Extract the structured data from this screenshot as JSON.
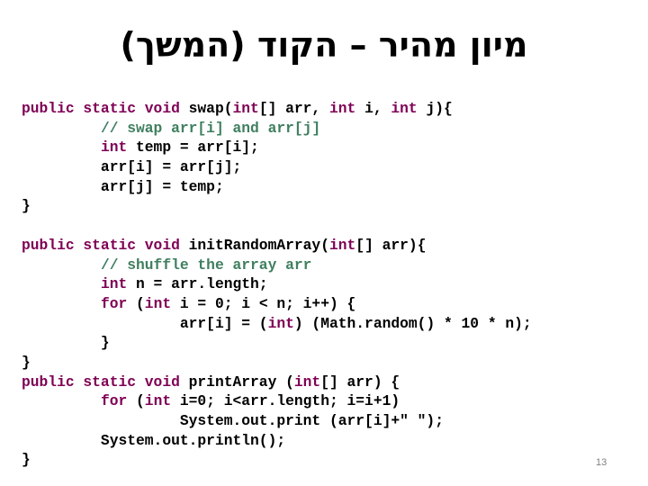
{
  "slide": {
    "title": "מיון מהיר – הקוד (המשך)",
    "page_number": "13",
    "colors": {
      "keyword": "#7f0055",
      "comment": "#3f7f5f",
      "text": "#000000"
    }
  },
  "code_lines": [
    [
      {
        "t": "kw",
        "s": "public static void"
      },
      {
        "t": "tx",
        "s": " swap("
      },
      {
        "t": "kw",
        "s": "int"
      },
      {
        "t": "tx",
        "s": "[] arr, "
      },
      {
        "t": "kw",
        "s": "int"
      },
      {
        "t": "tx",
        "s": " i, "
      },
      {
        "t": "kw",
        "s": "int"
      },
      {
        "t": "tx",
        "s": " j){"
      }
    ],
    [
      {
        "t": "tx",
        "s": "         "
      },
      {
        "t": "cm",
        "s": "// swap arr[i] and arr[j]"
      }
    ],
    [
      {
        "t": "tx",
        "s": "         "
      },
      {
        "t": "kw",
        "s": "int"
      },
      {
        "t": "tx",
        "s": " temp = arr[i];"
      }
    ],
    [
      {
        "t": "tx",
        "s": "         arr[i] = arr[j];"
      }
    ],
    [
      {
        "t": "tx",
        "s": "         arr[j] = temp;"
      }
    ],
    [
      {
        "t": "tx",
        "s": "}"
      }
    ],
    [
      {
        "t": "tx",
        "s": ""
      }
    ],
    [
      {
        "t": "kw",
        "s": "public static void"
      },
      {
        "t": "tx",
        "s": " initRandomArray("
      },
      {
        "t": "kw",
        "s": "int"
      },
      {
        "t": "tx",
        "s": "[] arr){"
      }
    ],
    [
      {
        "t": "tx",
        "s": "         "
      },
      {
        "t": "cm",
        "s": "// shuffle the array arr"
      }
    ],
    [
      {
        "t": "tx",
        "s": "         "
      },
      {
        "t": "kw",
        "s": "int"
      },
      {
        "t": "tx",
        "s": " n = arr.length;"
      }
    ],
    [
      {
        "t": "tx",
        "s": "         "
      },
      {
        "t": "kw",
        "s": "for"
      },
      {
        "t": "tx",
        "s": " ("
      },
      {
        "t": "kw",
        "s": "int"
      },
      {
        "t": "tx",
        "s": " i = 0; i < n; i++) {"
      }
    ],
    [
      {
        "t": "tx",
        "s": "                  arr[i] = ("
      },
      {
        "t": "kw",
        "s": "int"
      },
      {
        "t": "tx",
        "s": ") (Math.random() * 10 * n);"
      }
    ],
    [
      {
        "t": "tx",
        "s": "         }"
      }
    ],
    [
      {
        "t": "tx",
        "s": "}"
      }
    ],
    [
      {
        "t": "kw",
        "s": "public static void"
      },
      {
        "t": "tx",
        "s": " printArray ("
      },
      {
        "t": "kw",
        "s": "int"
      },
      {
        "t": "tx",
        "s": "[] arr) {"
      }
    ],
    [
      {
        "t": "tx",
        "s": "         "
      },
      {
        "t": "kw",
        "s": "for"
      },
      {
        "t": "tx",
        "s": " ("
      },
      {
        "t": "kw",
        "s": "int"
      },
      {
        "t": "tx",
        "s": " i=0; i<arr.length; i=i+1)"
      }
    ],
    [
      {
        "t": "tx",
        "s": "                  System.out.print (arr[i]+\" \");"
      }
    ],
    [
      {
        "t": "tx",
        "s": "         System.out.println();"
      }
    ],
    [
      {
        "t": "tx",
        "s": "}"
      }
    ]
  ]
}
